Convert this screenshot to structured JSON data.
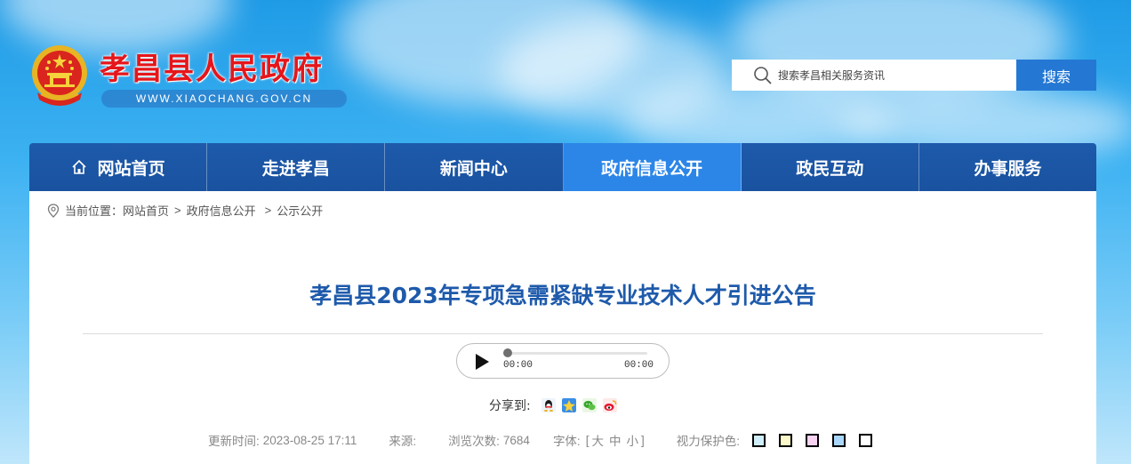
{
  "header": {
    "site_title": "孝昌县人民政府",
    "site_url": "WWW.XIAOCHANG.GOV.CN",
    "emblem_icon": "national-emblem-icon"
  },
  "search": {
    "placeholder": "搜索孝昌相关服务资讯",
    "button_label": "搜索"
  },
  "nav": {
    "items": [
      {
        "label": "网站首页",
        "icon": "home-icon"
      },
      {
        "label": "走进孝昌"
      },
      {
        "label": "新闻中心"
      },
      {
        "label": "政府信息公开",
        "active": true
      },
      {
        "label": "政民互动"
      },
      {
        "label": "办事服务"
      }
    ]
  },
  "breadcrumb": {
    "prefix": "当前位置：",
    "items": [
      "网站首页",
      "政府信息公开",
      "公示公开"
    ],
    "separator": ">"
  },
  "article": {
    "title": "孝昌县2023年专项急需紧缺专业技术人才引进公告"
  },
  "audio": {
    "current_time": "00:00",
    "total_time": "00:00"
  },
  "share": {
    "label": "分享到:",
    "icons": [
      "qq-icon",
      "qzone-icon",
      "wechat-icon",
      "weibo-icon"
    ]
  },
  "meta": {
    "update_label": "更新时间:",
    "update_value": "2023-08-25 17:11",
    "source_label": "来源:",
    "views_label": "浏览次数:",
    "views_value": "7684",
    "font_label": "字体:",
    "font_open": "[",
    "font_large": "大",
    "font_medium": "中",
    "font_small": "小",
    "font_close": "]",
    "eye_care_label": "视力保护色:",
    "eye_care_colors": [
      "#cfeefa",
      "#faf8c9",
      "#f7d3f1",
      "#a9d7fb",
      "#ffffff"
    ]
  },
  "colors": {
    "title_red": "#e5161b",
    "nav_blue": "#1e5aab",
    "nav_active": "#2c86e8",
    "search_button": "#2478d4",
    "article_title": "#1e5aab"
  }
}
